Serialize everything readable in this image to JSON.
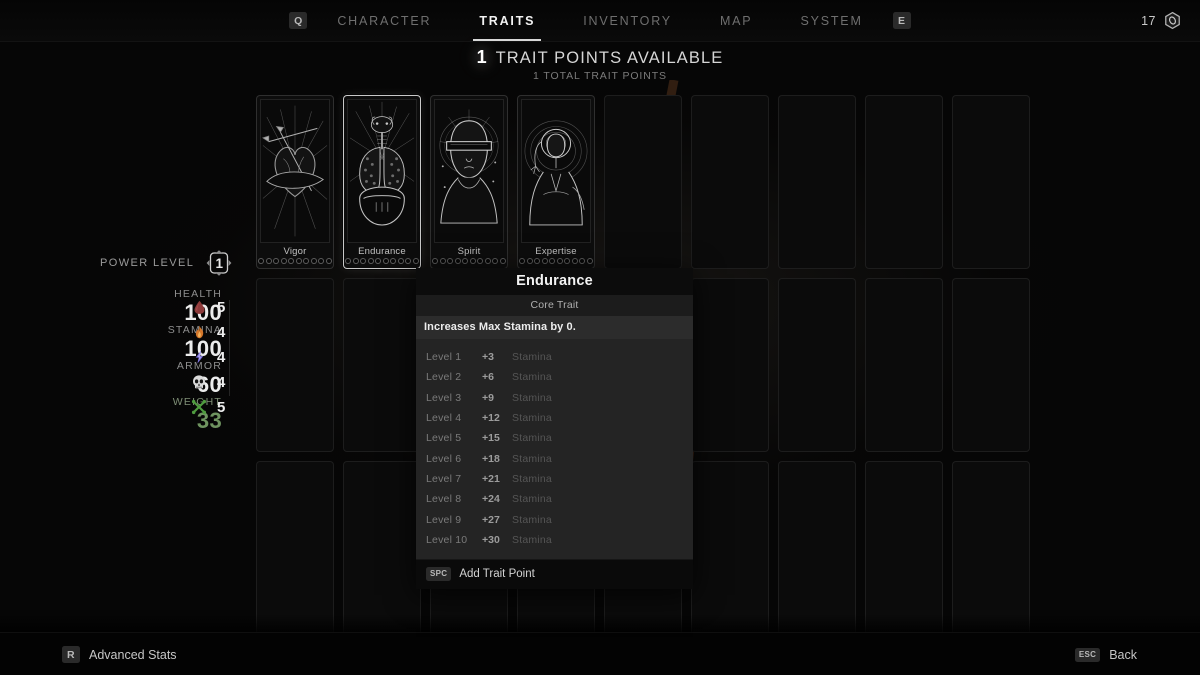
{
  "nav": {
    "prev_key": "Q",
    "next_key": "E",
    "tabs": [
      {
        "label": "CHARACTER",
        "active": false
      },
      {
        "label": "TRAITS",
        "active": true
      },
      {
        "label": "INVENTORY",
        "active": false
      },
      {
        "label": "MAP",
        "active": false
      },
      {
        "label": "SYSTEM",
        "active": false
      }
    ],
    "currency": {
      "amount": "17",
      "icon": "scrap-icon"
    }
  },
  "header": {
    "available_points": "1",
    "available_label": "TRAIT POINTS AVAILABLE",
    "total_label": "1 TOTAL TRAIT POINTS"
  },
  "stats": {
    "power_level_label": "POWER LEVEL",
    "power_level_value": "1",
    "primary": [
      {
        "name": "HEALTH",
        "value": "100"
      },
      {
        "name": "STAMINA",
        "value": "100"
      },
      {
        "name": "ARMOR",
        "value": "60"
      },
      {
        "name": "WEIGHT",
        "value": "33",
        "accent": "#6f9460"
      }
    ],
    "resistances": [
      {
        "icon": "blood-drop-icon",
        "value": "5",
        "color": "#8d3a3a"
      },
      {
        "icon": "flame-icon",
        "value": "4",
        "color": "#d4762a"
      },
      {
        "icon": "lightning-icon",
        "value": "4",
        "color": "#7b6fe0"
      },
      {
        "icon": "skull-icon",
        "value": "4",
        "color": "#d8d8d8"
      },
      {
        "icon": "bones-icon",
        "value": "5",
        "color": "#4f9c3f"
      }
    ]
  },
  "grid": {
    "columns": 9,
    "rows": 3,
    "cards": [
      {
        "name": "Vigor",
        "art": "heart-arrows-icon",
        "selected": false,
        "pips": 10,
        "filled": 0
      },
      {
        "name": "Endurance",
        "art": "lungs-icon",
        "selected": true,
        "pips": 10,
        "filled": 0
      },
      {
        "name": "Spirit",
        "art": "blindfolded-head-icon",
        "selected": false,
        "pips": 10,
        "filled": 0
      },
      {
        "name": "Expertise",
        "art": "haloed-figure-icon",
        "selected": false,
        "pips": 10,
        "filled": 0
      }
    ],
    "empty_slots_row1": 5,
    "empty_slots_row2": 9,
    "empty_slots_row3": 9
  },
  "tooltip": {
    "title": "Endurance",
    "subtitle": "Core Trait",
    "description": "Increases Max Stamina by 0.",
    "levels": [
      {
        "level": "Level 1",
        "amount": "+3",
        "stat": "Stamina"
      },
      {
        "level": "Level 2",
        "amount": "+6",
        "stat": "Stamina"
      },
      {
        "level": "Level 3",
        "amount": "+9",
        "stat": "Stamina"
      },
      {
        "level": "Level 4",
        "amount": "+12",
        "stat": "Stamina"
      },
      {
        "level": "Level 5",
        "amount": "+15",
        "stat": "Stamina"
      },
      {
        "level": "Level 6",
        "amount": "+18",
        "stat": "Stamina"
      },
      {
        "level": "Level 7",
        "amount": "+21",
        "stat": "Stamina"
      },
      {
        "level": "Level 8",
        "amount": "+24",
        "stat": "Stamina"
      },
      {
        "level": "Level 9",
        "amount": "+27",
        "stat": "Stamina"
      },
      {
        "level": "Level 10",
        "amount": "+30",
        "stat": "Stamina"
      }
    ],
    "action_key": "SPC",
    "action_label": "Add Trait Point"
  },
  "footer": {
    "left_key": "R",
    "left_label": "Advanced Stats",
    "right_key": "ESC",
    "right_label": "Back"
  }
}
